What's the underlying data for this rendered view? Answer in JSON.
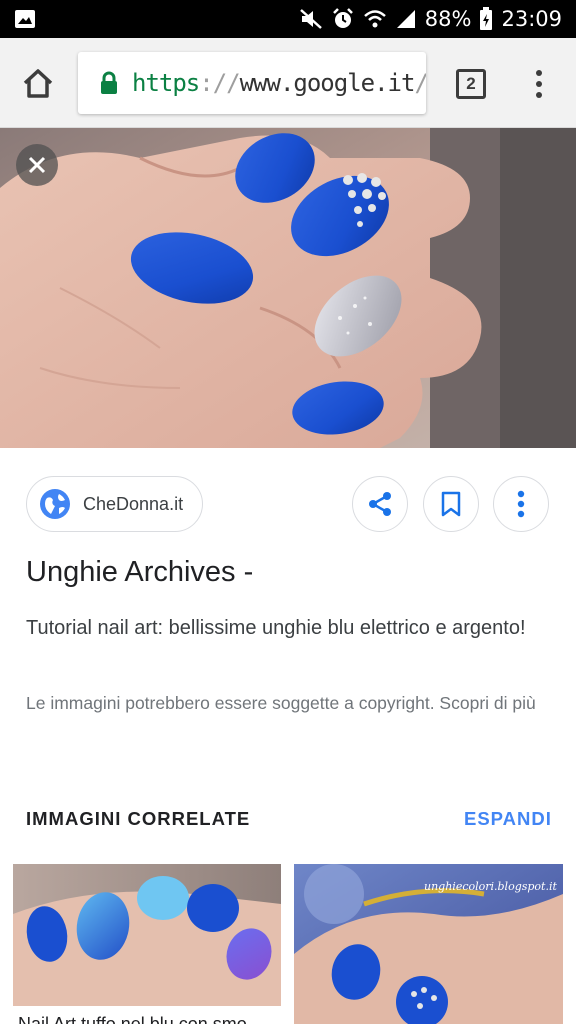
{
  "status_bar": {
    "battery_percent": "88%",
    "time": "23:09",
    "icons": [
      "gallery-icon",
      "mute-icon",
      "alarm-icon",
      "wifi-icon",
      "signal-icon",
      "battery-icon"
    ]
  },
  "browser": {
    "url_scheme": "https",
    "url_separator": "://",
    "url_host": "www.google.it",
    "url_rest": "/se",
    "tab_count": "2"
  },
  "result": {
    "source_name": "CheDonna.it",
    "title": "Unghie Archives -",
    "description": "Tutorial nail art: bellissime unghie blu elettrico e argento!",
    "copyright_notice": "Le immagini potrebbero essere soggette a copyright. Scopri di più"
  },
  "related": {
    "label": "IMMAGINI CORRELATE",
    "expand_label": "ESPANDI",
    "items": [
      {
        "caption": "Nail Art tuffo nel blu con smo"
      },
      {
        "watermark": "unghiecolori.blogspot.it"
      }
    ]
  },
  "colors": {
    "accent": "#4285f4",
    "secure_green": "#0b8043",
    "nail_blue": "#1a4fd0"
  }
}
